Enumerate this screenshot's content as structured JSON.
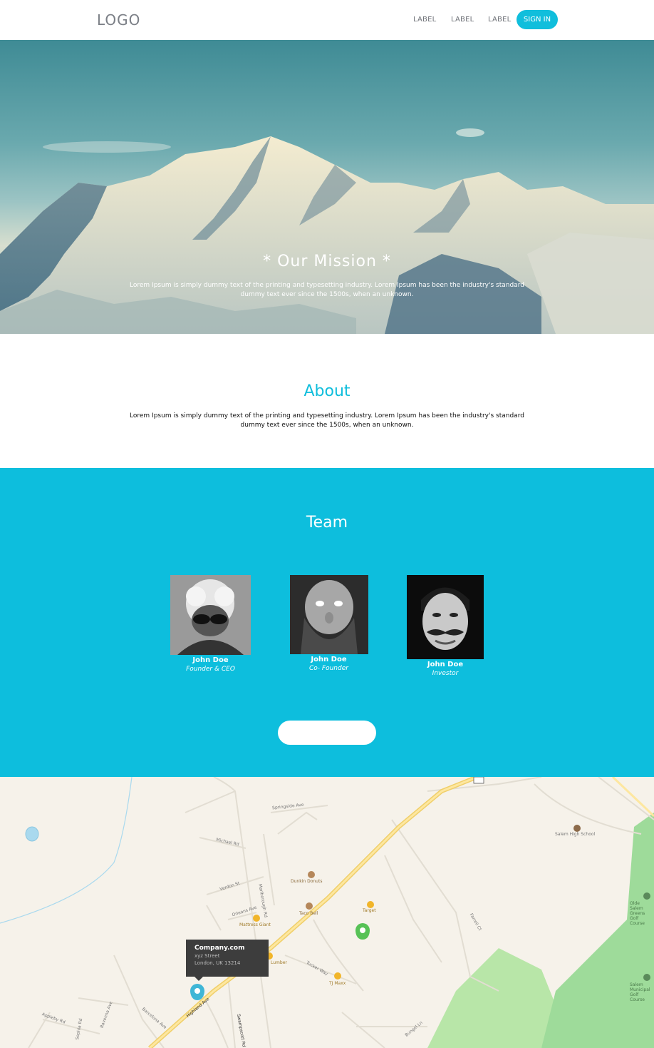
{
  "header": {
    "logo": "LOGO",
    "nav": [
      "LABEL",
      "LABEL",
      "LABEL"
    ],
    "signin": "SIGN IN"
  },
  "hero": {
    "title": "* Our Mission *",
    "text": "Lorem Ipsum is simply dummy text of the printing and typesetting industry. Lorem Ipsum has been the industry's standard dummy text ever since the 1500s, when an unknown."
  },
  "about": {
    "title": "About",
    "text": "Lorem Ipsum is simply dummy text of the printing and typesetting industry. Lorem Ipsum has been the industry's standard dummy text ever since the 1500s, when an unknown."
  },
  "team": {
    "title": "Team",
    "members": [
      {
        "name": "John Doe",
        "role": "Founder & CEO"
      },
      {
        "name": "John Doe",
        "role": "Co- Founder"
      },
      {
        "name": "John Doe",
        "role": "Investor"
      }
    ],
    "button": ""
  },
  "map": {
    "tooltip": {
      "company": "Company.com",
      "street": "xyz Street",
      "city": "London, UK 13214"
    },
    "places": [
      "Salem High School",
      "Dunkin Donuts",
      "Taco Bell",
      "Target",
      "Mattress Giant",
      "TJ Maxx",
      "Lumber",
      "Olde Salem Greens Golf Course",
      "Salem Municipal Golf Course"
    ],
    "streets": [
      "Springside Ave",
      "Michael Rd",
      "Marlborough Rd",
      "Orleans Ave",
      "Verdon St",
      "Highland Ave",
      "Swampscott Rd",
      "Barcelona Ave",
      "Appleby Rd",
      "Ravenna Ave",
      "Sophia Rd",
      "Farrell Ct",
      "Tucker Way",
      "Bungel Ln",
      "Osborne Hill Rd",
      "Glenn Ave",
      "Grove St",
      "Loring Ave",
      "Vinnin Sq",
      "Pollard St",
      "Tax St",
      "Kenneth St"
    ],
    "route_shield": "107",
    "colors": {
      "land": "#f6f2ea",
      "road": "#fbdc7a",
      "park": "#9edb9a",
      "water": "#a9d9ee"
    }
  }
}
